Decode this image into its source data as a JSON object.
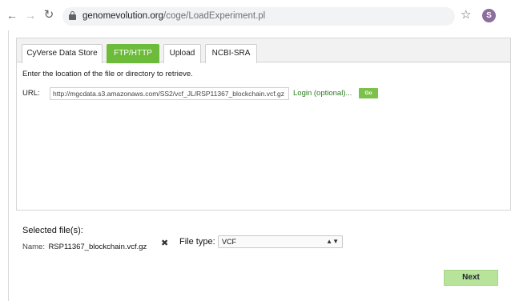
{
  "browser": {
    "url_host": "genomevolution.org",
    "url_path": "/coge/LoadExperiment.pl",
    "profile_initial": "S"
  },
  "tabs": [
    {
      "label": "CyVerse Data Store",
      "active": false
    },
    {
      "label": "FTP/HTTP",
      "active": true
    },
    {
      "label": "Upload",
      "active": false
    },
    {
      "label": "NCBI-SRA",
      "active": false
    }
  ],
  "ftp": {
    "instruction": "Enter the location of the file or directory to retrieve.",
    "url_label": "URL:",
    "url_value": "http://mgcdata.s3.amazonaws.com/SS2/vcf_JL/RSP11367_blockchain.vcf.gz",
    "login_link": "Login (optional)...",
    "go_label": "Go"
  },
  "selected": {
    "title": "Selected file(s):",
    "name_label": "Name:",
    "name_value": "RSP11367_blockchain.vcf.gz",
    "file_type_label": "File type:",
    "file_type_value": "VCF"
  },
  "next_label": "Next",
  "colors": {
    "accent_green": "#6dbb3a",
    "link_green": "#2a7a1e",
    "next_button": "#b8e39a"
  }
}
